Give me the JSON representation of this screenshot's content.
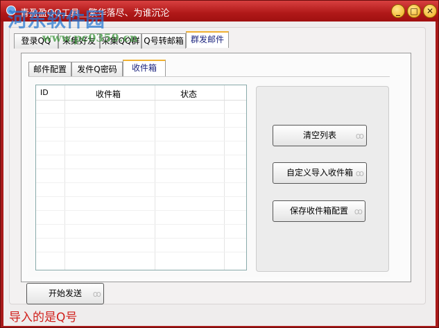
{
  "window": {
    "title": "青盈盈QQ工具＿繁华落尽、为谁沉沦",
    "minimize": "_",
    "maximize": "□",
    "close": "✕"
  },
  "watermark": {
    "name": "河东软件园",
    "url": "www.pc0359.cn"
  },
  "main_tabs": [
    "登录QQ",
    "采集好友",
    "采集QQ群",
    "Q号转邮箱",
    "群发邮件"
  ],
  "sub_tabs": [
    "邮件配置",
    "发件Q密码",
    "收件箱"
  ],
  "list": {
    "columns": [
      "ID",
      "收件箱",
      "状态"
    ]
  },
  "buttons": {
    "clear": "清空列表",
    "import": "自定义导入收件箱",
    "save": "保存收件箱配置",
    "start": "开始发送"
  },
  "status": "导入的是Q号"
}
